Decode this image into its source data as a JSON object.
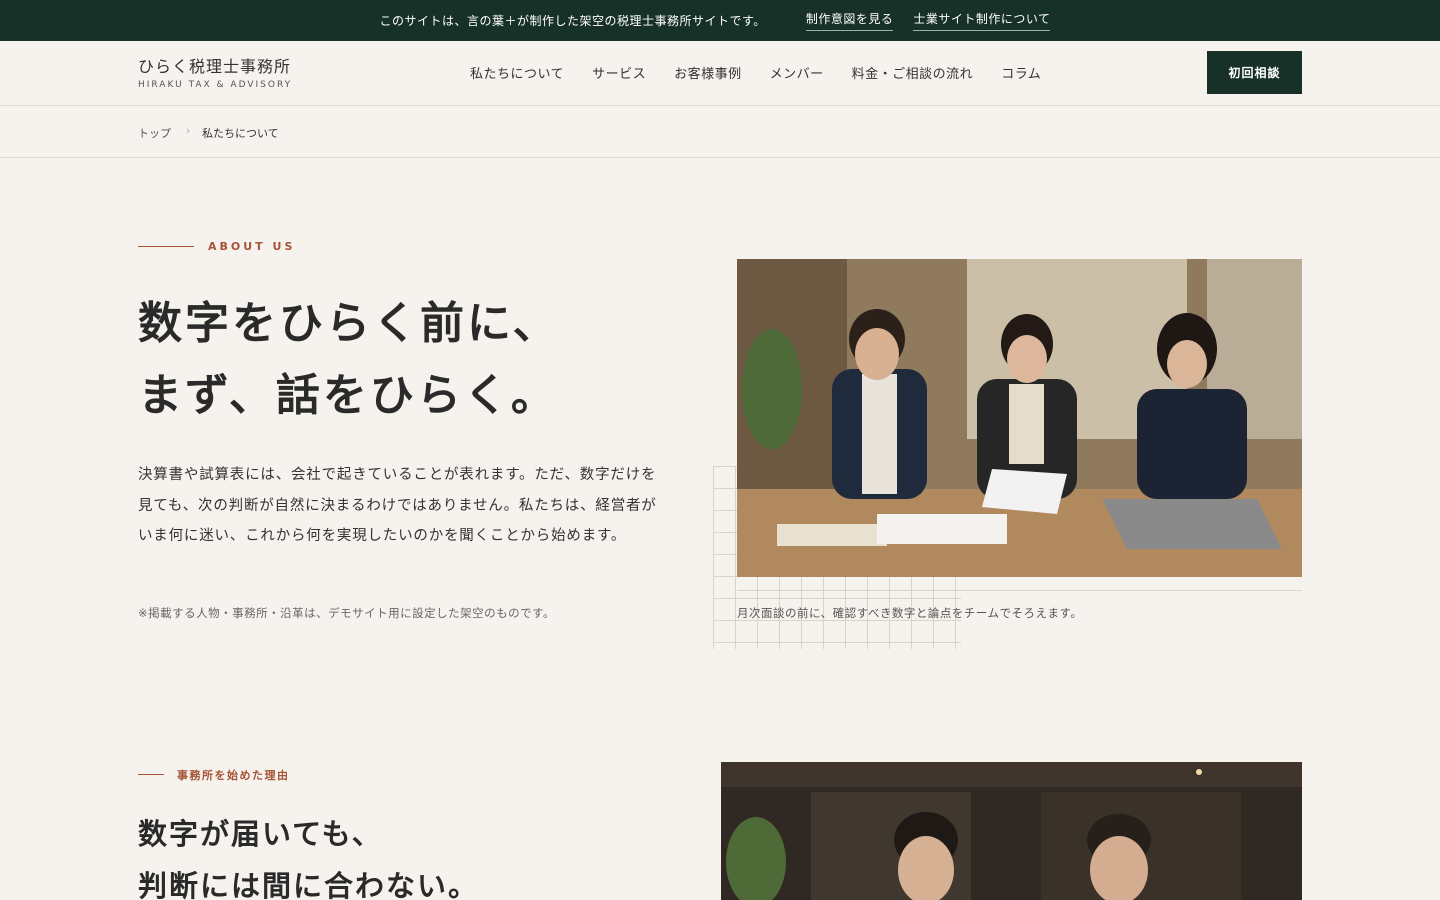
{
  "topbar": {
    "message": "このサイトは、言の葉＋が制作した架空の税理士事務所サイトです。",
    "link1": "制作意図を見る",
    "link2": "士業サイト制作について"
  },
  "header": {
    "logo_main": "ひらく税理士事務所",
    "logo_sub": "HIRAKU TAX & ADVISORY",
    "nav": [
      "私たちについて",
      "サービス",
      "お客様事例",
      "メンバー",
      "料金・ご相談の流れ",
      "コラム"
    ],
    "cta": "初回相談"
  },
  "breadcrumb": {
    "home": "トップ",
    "separator": "›",
    "current": "私たちについて"
  },
  "about": {
    "eyebrow": "ABOUT US",
    "headline_line1": "数字をひらく前に、",
    "headline_line2": "まず、話をひらく。",
    "body": "決算書や試算表には、会社で起きていることが表れます。ただ、数字だけを見ても、次の判断が自然に決まるわけではありません。私たちは、経営者がいま何に迷い、これから何を実現したいのかを聞くことから始めます。",
    "note": "※掲載する人物・事務所・沿革は、デモサイト用に設定した架空のものです。",
    "caption": "月次面談の前に、確認すべき数字と論点をチームでそろえます。"
  },
  "reason": {
    "eyebrow": "事務所を始めた理由",
    "headline_line1": "数字が届いても、",
    "headline_line2": "判断には間に合わない。"
  },
  "colors": {
    "accent": "#a65338",
    "brand": "#173028",
    "background": "#f6f3ee"
  }
}
